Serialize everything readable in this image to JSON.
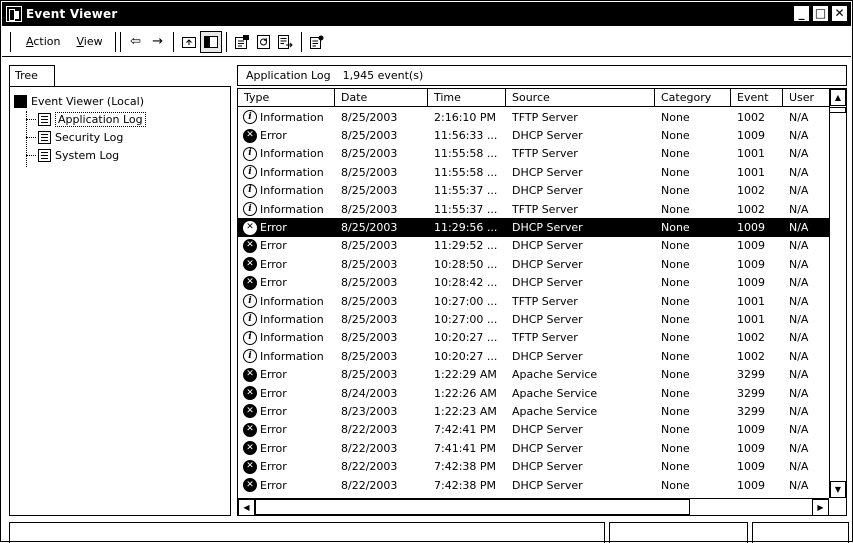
{
  "window": {
    "title": "Event Viewer",
    "buttons": {
      "minimize": "_",
      "maximize": "□",
      "close": "✕"
    }
  },
  "menu": {
    "action": {
      "accel": "A",
      "rest": "ction"
    },
    "view": {
      "accel": "V",
      "rest": "iew"
    }
  },
  "toolbar": {
    "back": "⇦",
    "forward": "→"
  },
  "tree": {
    "tab_label": "Tree",
    "root": "Event Viewer (Local)",
    "items": [
      "Application Log",
      "Security Log",
      "System Log"
    ],
    "selected_index": 0
  },
  "list": {
    "log_name": "Application Log",
    "event_count": "1,945 event(s)",
    "columns": [
      "Type",
      "Date",
      "Time",
      "Source",
      "Category",
      "Event",
      "User"
    ],
    "selected_row": 6,
    "rows": [
      {
        "type": "Information",
        "date": "8/25/2003",
        "time": "2:16:10 PM",
        "source": "TFTP Server",
        "category": "None",
        "event": "1002",
        "user": "N/A"
      },
      {
        "type": "Error",
        "date": "8/25/2003",
        "time": "11:56:33 ...",
        "source": "DHCP Server",
        "category": "None",
        "event": "1009",
        "user": "N/A"
      },
      {
        "type": "Information",
        "date": "8/25/2003",
        "time": "11:55:58 ...",
        "source": "TFTP Server",
        "category": "None",
        "event": "1001",
        "user": "N/A"
      },
      {
        "type": "Information",
        "date": "8/25/2003",
        "time": "11:55:58 ...",
        "source": "DHCP Server",
        "category": "None",
        "event": "1001",
        "user": "N/A"
      },
      {
        "type": "Information",
        "date": "8/25/2003",
        "time": "11:55:37 ...",
        "source": "DHCP Server",
        "category": "None",
        "event": "1002",
        "user": "N/A"
      },
      {
        "type": "Information",
        "date": "8/25/2003",
        "time": "11:55:37 ...",
        "source": "TFTP Server",
        "category": "None",
        "event": "1002",
        "user": "N/A"
      },
      {
        "type": "Error",
        "date": "8/25/2003",
        "time": "11:29:56 ...",
        "source": "DHCP Server",
        "category": "None",
        "event": "1009",
        "user": "N/A"
      },
      {
        "type": "Error",
        "date": "8/25/2003",
        "time": "11:29:52 ...",
        "source": "DHCP Server",
        "category": "None",
        "event": "1009",
        "user": "N/A"
      },
      {
        "type": "Error",
        "date": "8/25/2003",
        "time": "10:28:50 ...",
        "source": "DHCP Server",
        "category": "None",
        "event": "1009",
        "user": "N/A"
      },
      {
        "type": "Error",
        "date": "8/25/2003",
        "time": "10:28:42 ...",
        "source": "DHCP Server",
        "category": "None",
        "event": "1009",
        "user": "N/A"
      },
      {
        "type": "Information",
        "date": "8/25/2003",
        "time": "10:27:00 ...",
        "source": "TFTP Server",
        "category": "None",
        "event": "1001",
        "user": "N/A"
      },
      {
        "type": "Information",
        "date": "8/25/2003",
        "time": "10:27:00 ...",
        "source": "DHCP Server",
        "category": "None",
        "event": "1001",
        "user": "N/A"
      },
      {
        "type": "Information",
        "date": "8/25/2003",
        "time": "10:20:27 ...",
        "source": "TFTP Server",
        "category": "None",
        "event": "1002",
        "user": "N/A"
      },
      {
        "type": "Information",
        "date": "8/25/2003",
        "time": "10:20:27 ...",
        "source": "DHCP Server",
        "category": "None",
        "event": "1002",
        "user": "N/A"
      },
      {
        "type": "Error",
        "date": "8/25/2003",
        "time": "1:22:29 AM",
        "source": "Apache Service",
        "category": "None",
        "event": "3299",
        "user": "N/A"
      },
      {
        "type": "Error",
        "date": "8/24/2003",
        "time": "1:22:26 AM",
        "source": "Apache Service",
        "category": "None",
        "event": "3299",
        "user": "N/A"
      },
      {
        "type": "Error",
        "date": "8/23/2003",
        "time": "1:22:23 AM",
        "source": "Apache Service",
        "category": "None",
        "event": "3299",
        "user": "N/A"
      },
      {
        "type": "Error",
        "date": "8/22/2003",
        "time": "7:42:41 PM",
        "source": "DHCP Server",
        "category": "None",
        "event": "1009",
        "user": "N/A"
      },
      {
        "type": "Error",
        "date": "8/22/2003",
        "time": "7:41:41 PM",
        "source": "DHCP Server",
        "category": "None",
        "event": "1009",
        "user": "N/A"
      },
      {
        "type": "Error",
        "date": "8/22/2003",
        "time": "7:42:38 PM",
        "source": "DHCP Server",
        "category": "None",
        "event": "1009",
        "user": "N/A"
      },
      {
        "type": "Error",
        "date": "8/22/2003",
        "time": "7:42:38 PM",
        "source": "DHCP Server",
        "category": "None",
        "event": "1009",
        "user": "N/A"
      }
    ]
  }
}
